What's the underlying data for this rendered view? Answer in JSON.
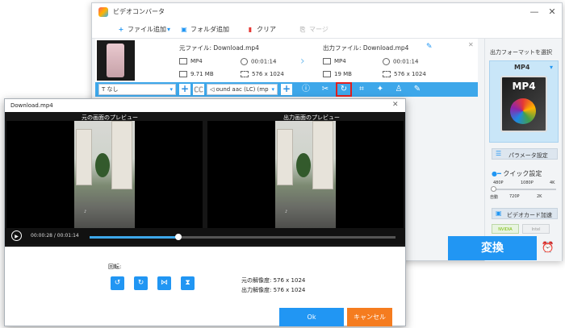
{
  "main_window": {
    "title": "ビデオコンバータ",
    "controls": {
      "minimize": "—",
      "close": "✕"
    },
    "toolbar": {
      "add_file": "ファイル追加",
      "add_folder": "フォルダ追加",
      "clear": "クリア",
      "merge": "マージ"
    },
    "file": {
      "source_label": "元ファイル: Download.mp4",
      "output_label": "出力ファイル: Download.mp4",
      "src_format": "MP4",
      "src_duration": "00:01:14",
      "src_size": "9.71 MB",
      "src_resolution": "576 x 1024",
      "out_format": "MP4",
      "out_duration": "00:01:14",
      "out_size": "19 MB",
      "out_resolution": "576 x 1024"
    },
    "edit_bar": {
      "subtitle_value": "なし",
      "audio_value": "ound aac (LC) (mp"
    },
    "right_panel": {
      "format_title": "出力フォーマットを選択",
      "format_value": "MP4",
      "format_art_text": "MP4",
      "param_button": "パラメータ設定",
      "quick_setting": "クイック設定",
      "quality_top": [
        "480P",
        "1080P",
        "4K"
      ],
      "quality_bottom": [
        "自動",
        "720P",
        "2K"
      ],
      "gpu_label": "ビデオカード加速",
      "nvidia": "NVIDIA",
      "intel": "Intel",
      "convert_button": "変換"
    }
  },
  "preview_dialog": {
    "title": "Download.mp4",
    "original_label": "元の画面のプレビュー",
    "output_label": "出力画面のプレビュー",
    "time_current": "00:00:28",
    "time_total": "00:01:14",
    "progress": 0.29,
    "rotate_label": "回転:",
    "original_resolution_label": "元の解像度:",
    "original_resolution": "576 x 1024",
    "output_resolution_label": "出力解像度:",
    "output_resolution": "576 x 1024",
    "ok_button": "Ok",
    "cancel_button": "キャンセル"
  },
  "colors": {
    "accent": "#2196f3",
    "edit_bar": "#3da7ea",
    "cancel": "#f57c1f",
    "highlight": "#e02020"
  }
}
